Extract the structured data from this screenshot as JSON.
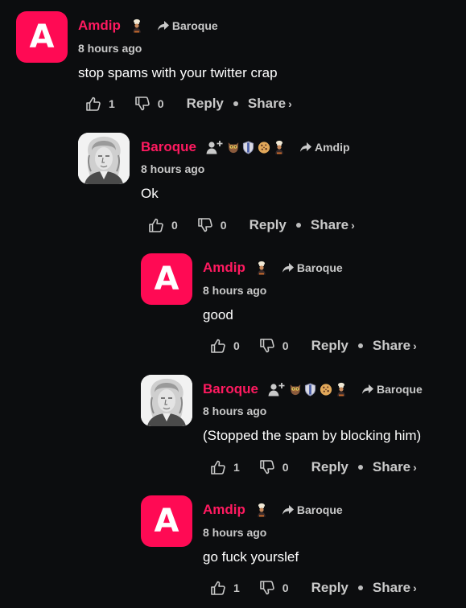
{
  "labels": {
    "reply": "Reply",
    "share": "Share",
    "share_chevron": "›"
  },
  "colors": {
    "background": "#0c0d0f",
    "author": "#ff1a60",
    "avatar_bg": "#ff0a54",
    "muted_text": "#c9c9c9"
  },
  "comments": [
    {
      "author": "Amdip",
      "avatar": "letter",
      "avatar_letter": "A",
      "badges": [
        "chef-badge"
      ],
      "reply_to": "Baroque",
      "time": "8 hours ago",
      "text": "stop spams with your twitter crap",
      "likes": "1",
      "dislikes": "0"
    },
    {
      "author": "Baroque",
      "avatar": "portrait",
      "badges": [
        "add-user-badge",
        "owl-badge",
        "shield-badge",
        "cookie-badge",
        "chef-badge"
      ],
      "reply_to": "Amdip",
      "time": "8 hours ago",
      "text": "Ok",
      "likes": "0",
      "dislikes": "0"
    },
    {
      "author": "Amdip",
      "avatar": "letter",
      "avatar_letter": "A",
      "badges": [
        "chef-badge"
      ],
      "reply_to": "Baroque",
      "time": "8 hours ago",
      "text": "good",
      "likes": "0",
      "dislikes": "0"
    },
    {
      "author": "Baroque",
      "avatar": "portrait",
      "badges": [
        "add-user-badge",
        "owl-badge",
        "shield-badge",
        "cookie-badge",
        "chef-badge"
      ],
      "reply_to": "Baroque",
      "time": "8 hours ago",
      "text": "(Stopped the spam by blocking him)",
      "likes": "1",
      "dislikes": "0"
    },
    {
      "author": "Amdip",
      "avatar": "letter",
      "avatar_letter": "A",
      "badges": [
        "chef-badge"
      ],
      "reply_to": "Baroque",
      "time": "8 hours ago",
      "text": "go fuck yourslef",
      "likes": "1",
      "dislikes": "0"
    }
  ]
}
